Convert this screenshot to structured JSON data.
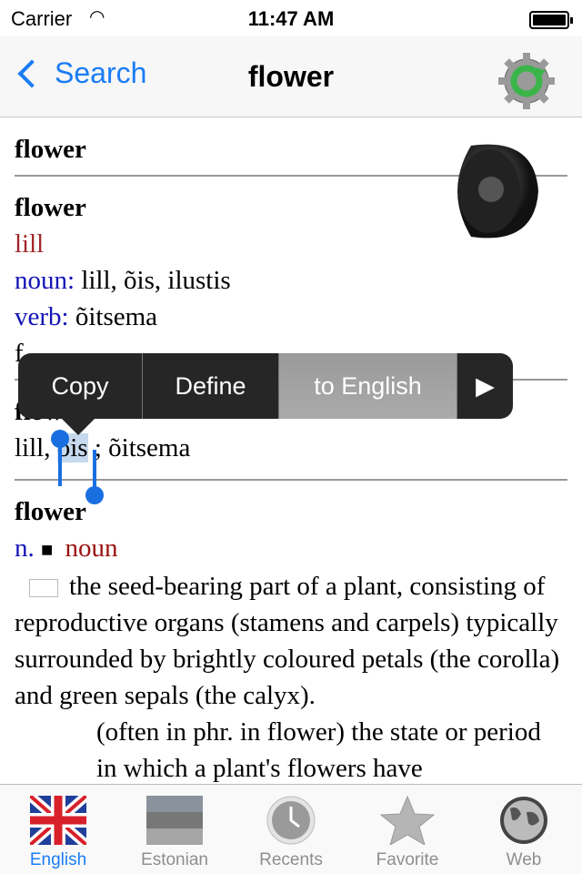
{
  "status": {
    "carrier": "Carrier",
    "time": "11:47 AM"
  },
  "nav": {
    "back": "Search",
    "title": "flower"
  },
  "entries": {
    "e1": {
      "headword": "flower"
    },
    "e2": {
      "headword": "flower",
      "translation": "lill",
      "noun_label": "noun:",
      "noun": " lill, õis, ilustis",
      "verb_label": "verb:",
      "verb": " õitsema",
      "hidden": "f"
    },
    "e3": {
      "headword": "flower",
      "pre": "lill, ",
      "selected": "õis",
      "post": " ; õitsema"
    },
    "e4": {
      "headword": "flower",
      "pos_abbr": "n.",
      "bullet": "■",
      "pos": "noun",
      "definition": "the seed-bearing part of a plant, consisting of reproductive organs (stamens and carpels) typically surrounded by brightly coloured petals (the corolla) and green sepals (the calyx).",
      "more": "(often in phr. in flower) the state or period in which a plant's flowers have"
    }
  },
  "menu": {
    "items": [
      "Copy",
      "Define",
      "to English"
    ],
    "more": "▶"
  },
  "tabs": [
    {
      "label": "English",
      "icon": "uk-flag-icon"
    },
    {
      "label": "Estonian",
      "icon": "estonia-flag-icon"
    },
    {
      "label": "Recents",
      "icon": "clock-icon"
    },
    {
      "label": "Favorite",
      "icon": "star-icon"
    },
    {
      "label": "Web",
      "icon": "globe-icon"
    }
  ],
  "colors": {
    "accent": "#1a7cf5",
    "translation": "#a3262a",
    "label": "#1414b8"
  }
}
